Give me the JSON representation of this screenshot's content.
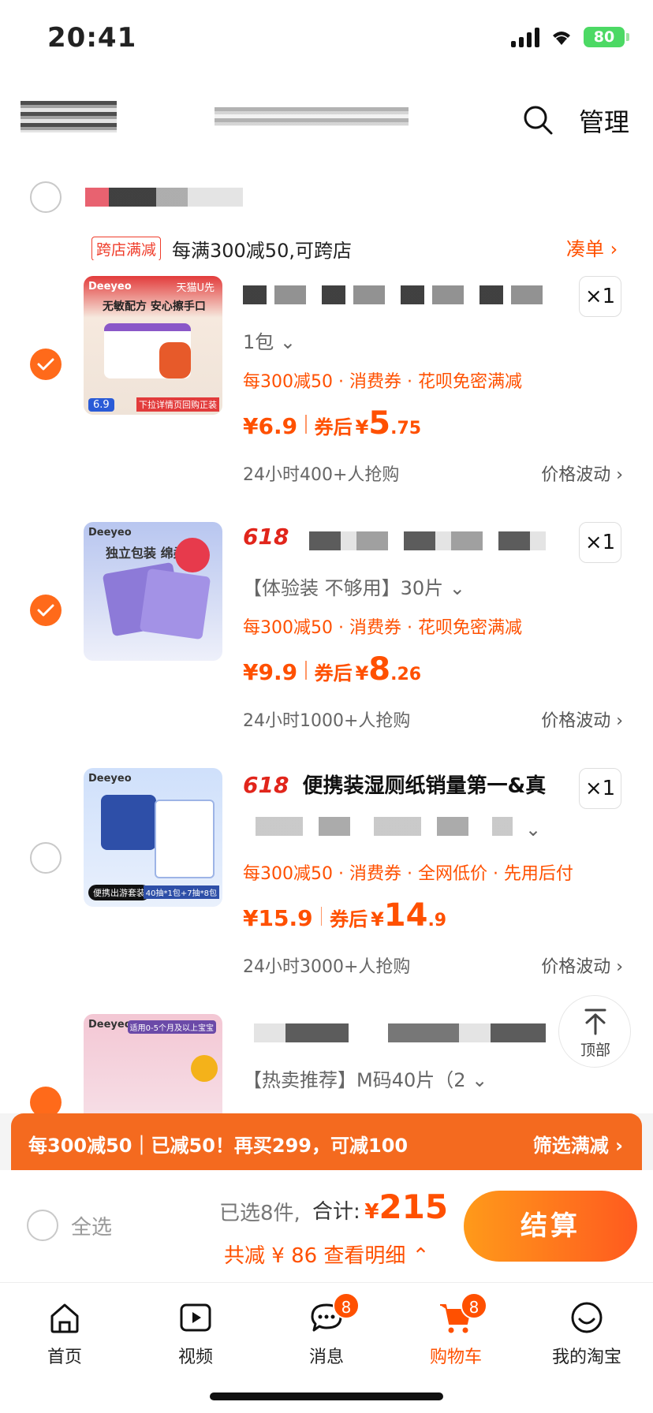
{
  "status": {
    "time": "20:41",
    "battery": "80"
  },
  "header": {
    "manage_label": "管理"
  },
  "store": {
    "promo_tag": "跨店满减",
    "promo_text": "每满300减50,可跨店",
    "coudan_label": "凑单 ›"
  },
  "items": [
    {
      "checked": true,
      "title": "",
      "spec": "1包 ⌄",
      "qty": "×1",
      "discounts": "每300减50 · 消费券 · 花呗免密满减",
      "price": "¥6.9",
      "after_label": "券后",
      "after_symbol": "¥",
      "after_int": "5",
      "after_dec": ".75",
      "sold": "24小时400+人抢购",
      "wave": "价格波动 ›",
      "thumb_brand": "Deeyeo",
      "thumb_caption": "无敏配方 安心擦手口",
      "thumb_tag": "天猫U先",
      "thumb_foot": "下拉详情页回购正装",
      "thumb_price": "6.9"
    },
    {
      "checked": true,
      "tag": "618",
      "title": "",
      "spec": "【体验装 不够用】30片 ⌄",
      "qty": "×1",
      "discounts": "每300减50 · 消费券 · 花呗免密满减",
      "price": "¥9.9",
      "after_label": "券后",
      "after_symbol": "¥",
      "after_int": "8",
      "after_dec": ".26",
      "sold": "24小时1000+人抢购",
      "wave": "价格波动 ›",
      "thumb_brand": "Deeyeo",
      "thumb_caption": "独立包装 绵柔"
    },
    {
      "checked": false,
      "tag": "618",
      "title": "便携装湿厕纸销量第一&真",
      "spec": "⌄",
      "qty": "×1",
      "discounts": "每300减50 · 消费券 · 全网低价 · 先用后付",
      "price": "¥15.9",
      "after_label": "券后",
      "after_symbol": "¥",
      "after_int": "14",
      "after_dec": ".9",
      "sold": "24小时3000+人抢购",
      "wave": "价格波动 ›",
      "thumb_brand": "Deeyeo",
      "thumb_foot": "便携出游套装",
      "thumb_foot2": "40抽*1包+7抽*8包"
    },
    {
      "checked": true,
      "title": "",
      "spec": "【热卖推荐】M码40片（2 ⌄",
      "thumb_brand": "Deeyeo",
      "thumb_caption": "适用0-5个月及以上宝宝"
    }
  ],
  "back_to_top": {
    "label": "顶部"
  },
  "promo_bar": {
    "left": "每300减50｜已减50！再买299，可减100",
    "right": "筛选满减 ›"
  },
  "checkout": {
    "select_all": "全选",
    "selected": "已选8件,",
    "total_label": "合计:",
    "total_symbol": "¥",
    "total": "215",
    "saved": "共减 ¥ 86  查看明细 ⌃",
    "pay": "结算"
  },
  "tabs": [
    {
      "label": "首页",
      "icon": "home-icon"
    },
    {
      "label": "视频",
      "icon": "video-icon"
    },
    {
      "label": "消息",
      "icon": "message-icon",
      "badge": "8"
    },
    {
      "label": "购物车",
      "icon": "cart-icon",
      "badge": "8",
      "active": true
    },
    {
      "label": "我的淘宝",
      "icon": "profile-icon"
    }
  ],
  "colors": {
    "accent": "#ff5000",
    "checkout_gradient": "#ff7a1f",
    "selected_radio": "#ff6a1a"
  }
}
